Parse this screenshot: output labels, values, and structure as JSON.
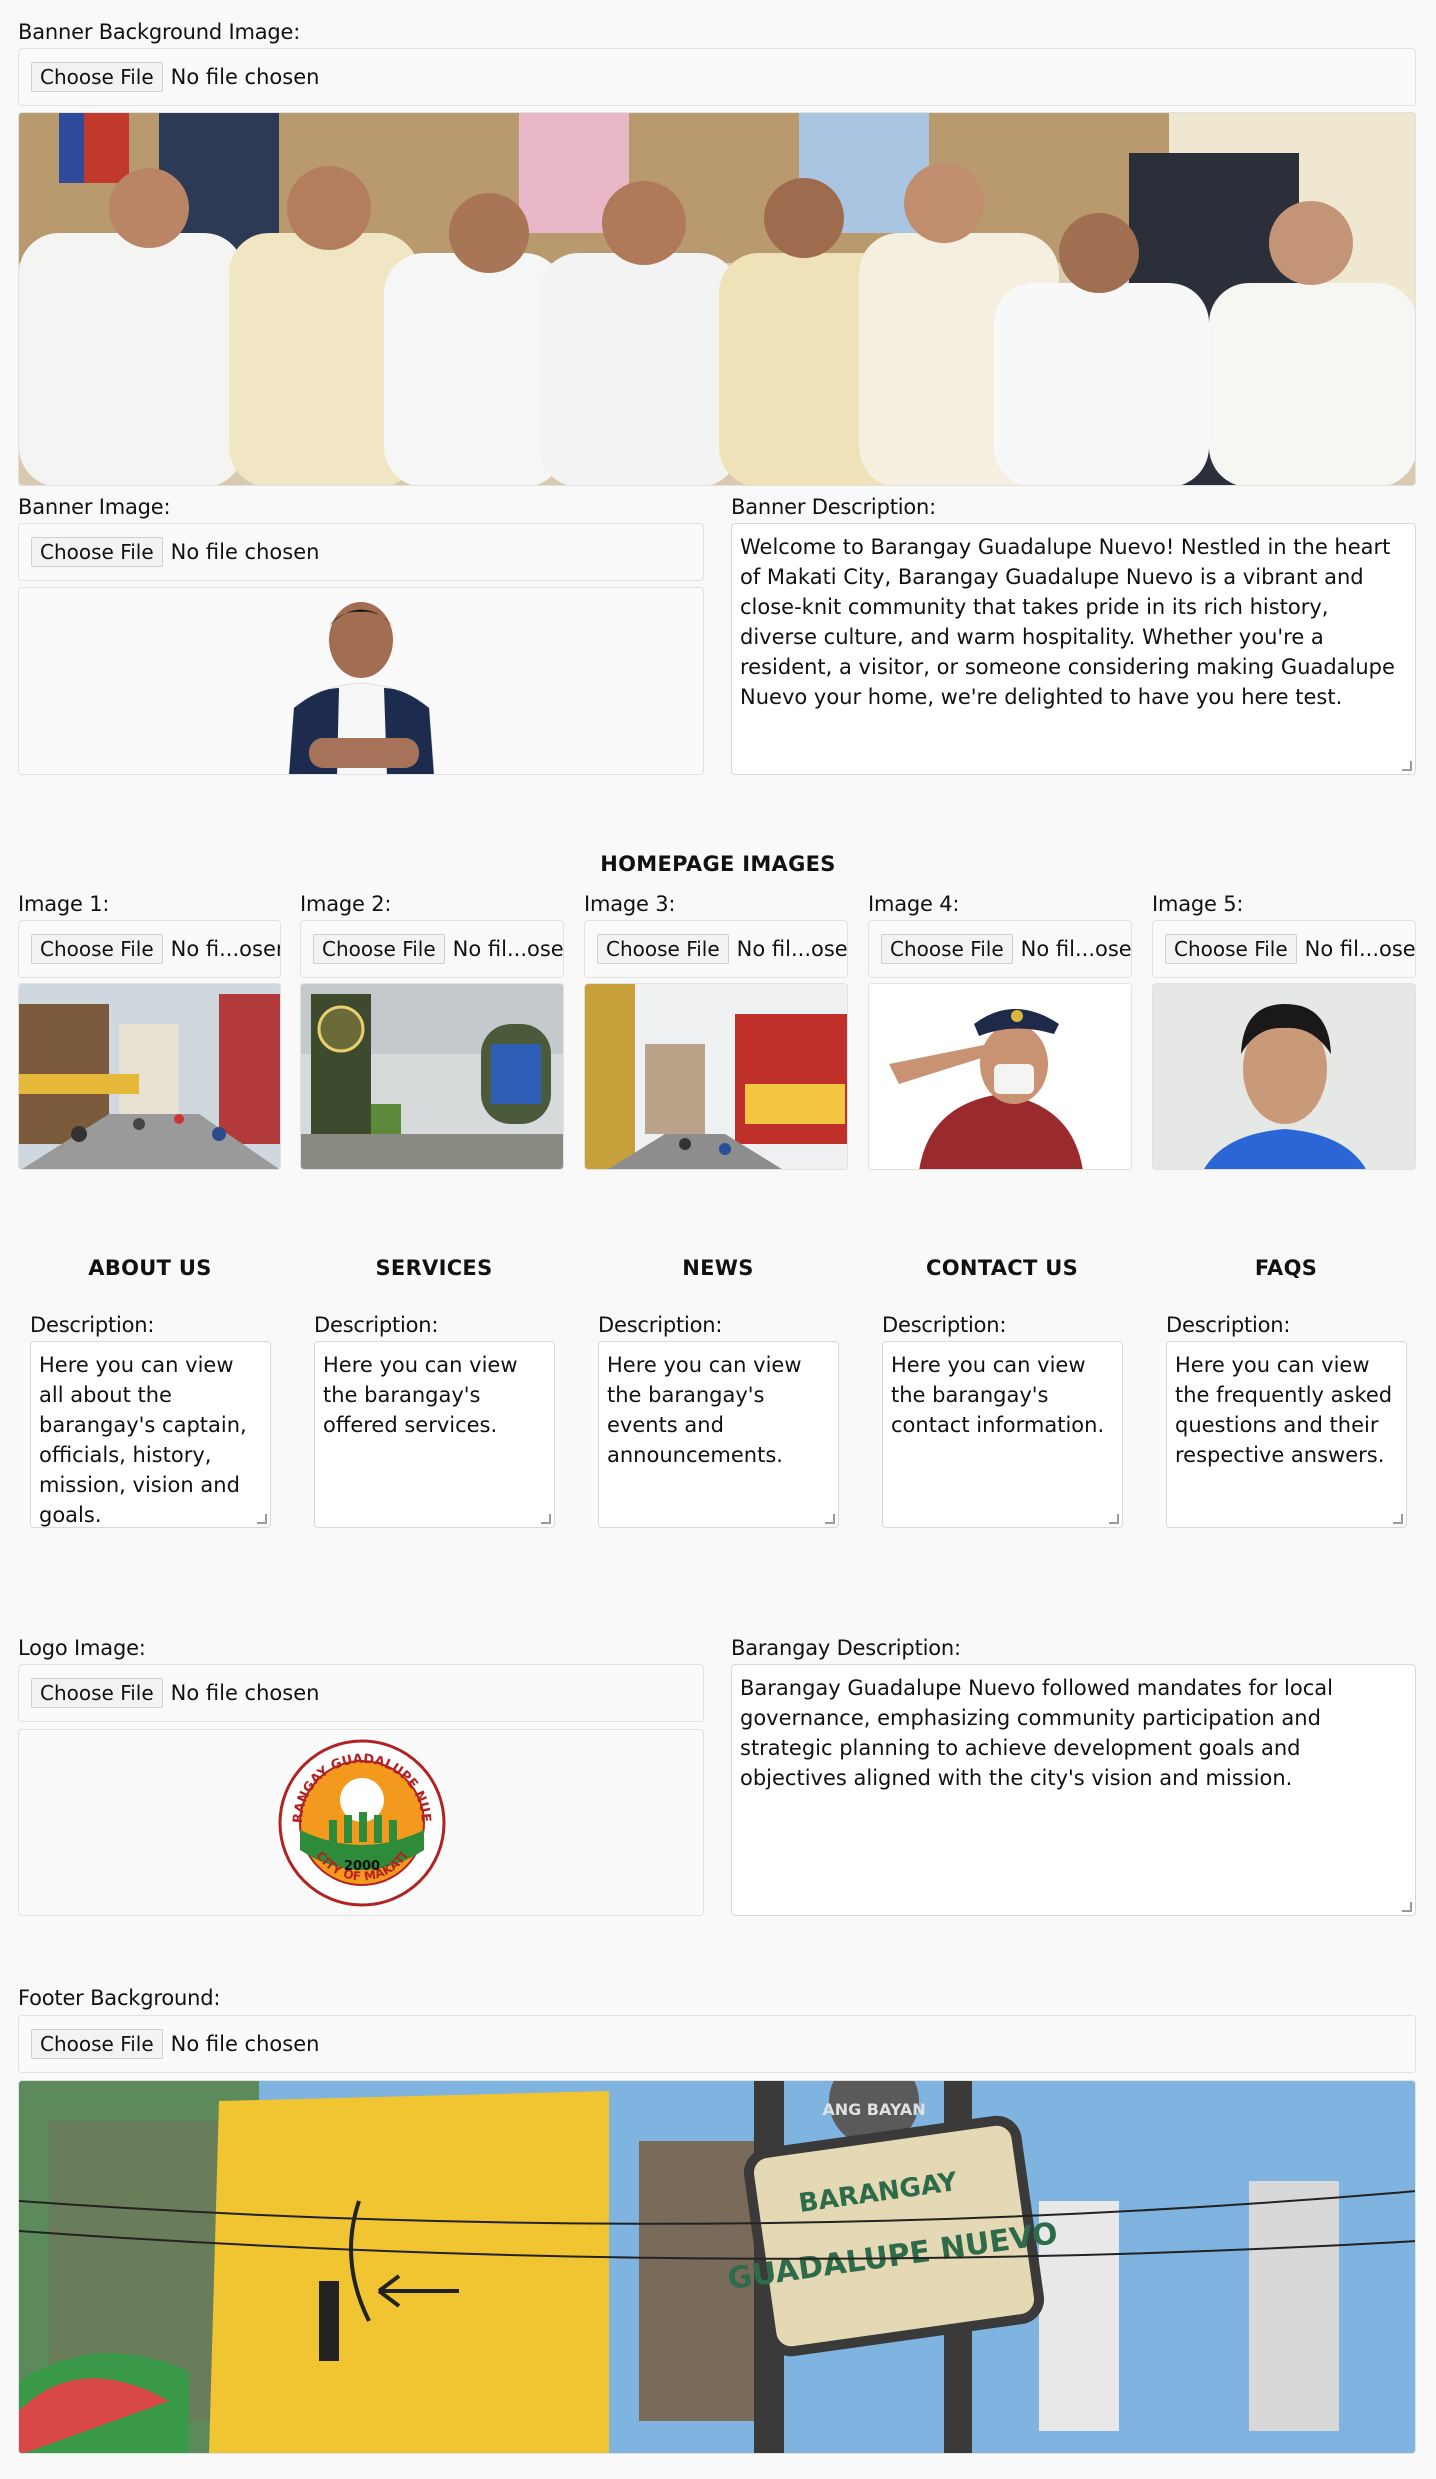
{
  "banner_bg": {
    "label": "Banner Background Image:",
    "button": "Choose File",
    "status": "No file chosen"
  },
  "banner_img": {
    "label": "Banner Image:",
    "button": "Choose File",
    "status": "No file chosen"
  },
  "banner_desc": {
    "label": "Banner Description:",
    "text": "Welcome to Barangay Guadalupe Nuevo! Nestled in the heart of Makati City, Barangay Guadalupe Nuevo is a vibrant and close-knit community that takes pride in its rich history, diverse culture, and warm hospitality. Whether you're a resident, a visitor, or someone considering making Guadalupe Nuevo your home, we're delighted to have you here test."
  },
  "homepage": {
    "title": "HOMEPAGE IMAGES",
    "images": [
      {
        "label": "Image 1:",
        "button": "Choose File",
        "status": "No fi...osen"
      },
      {
        "label": "Image 2:",
        "button": "Choose File",
        "status": "No fil...osen"
      },
      {
        "label": "Image 3:",
        "button": "Choose File",
        "status": "No fil...osen"
      },
      {
        "label": "Image 4:",
        "button": "Choose File",
        "status": "No fil...osen"
      },
      {
        "label": "Image 5:",
        "button": "Choose File",
        "status": "No fil...osen"
      }
    ]
  },
  "sections": [
    {
      "title": "ABOUT US",
      "label": "Description:",
      "text": "Here you can view all about the barangay's captain, officials, history, mission, vision and goals."
    },
    {
      "title": "SERVICES",
      "label": "Description:",
      "text": "Here you can view the barangay's offered services."
    },
    {
      "title": "NEWS",
      "label": "Description:",
      "text": "Here you can view the barangay's events and announcements."
    },
    {
      "title": "CONTACT US",
      "label": "Description:",
      "text": "Here you can view the barangay's contact information."
    },
    {
      "title": "FAQS",
      "label": "Description:",
      "text": "Here you can view the frequently asked questions and their respective answers."
    }
  ],
  "logo": {
    "label": "Logo Image:",
    "button": "Choose File",
    "status": "No file chosen",
    "seal_top": "BARANGAY GUADALUPE NUEVO",
    "seal_bottom": "CITY OF MAKATI",
    "seal_year": "2000"
  },
  "brgy_desc": {
    "label": "Barangay Description:",
    "text": "Barangay Guadalupe Nuevo followed mandates for local governance, emphasizing community participation and strategic planning to achieve development goals and objectives aligned with the city's vision and mission."
  },
  "footer": {
    "label": "Footer Background:",
    "button": "Choose File",
    "status": "No file chosen",
    "sign_top": "BARANGAY",
    "sign_main": "GUADALUPE NUEVO",
    "sign_small": "ANG BAYAN"
  }
}
